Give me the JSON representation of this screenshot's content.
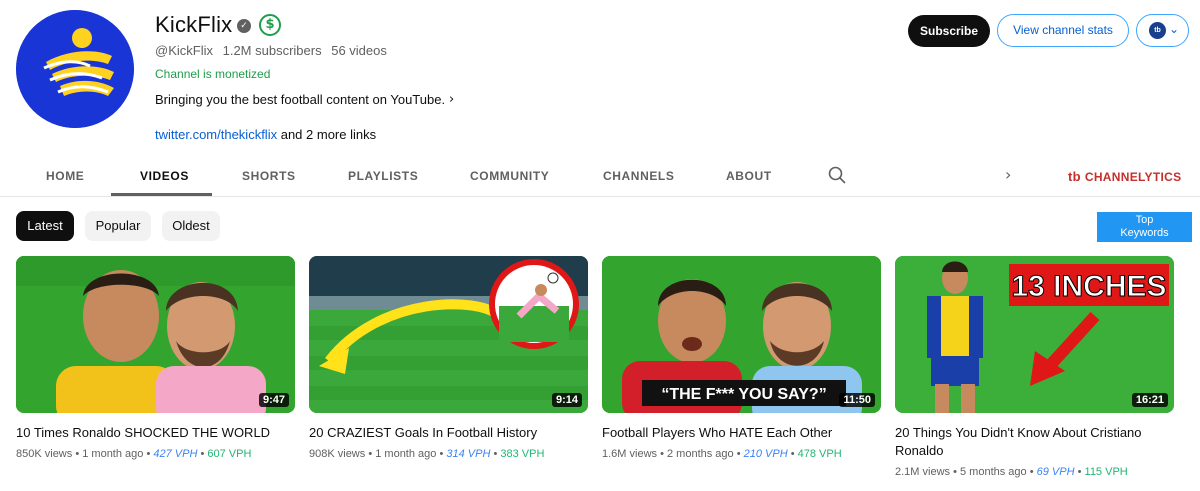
{
  "channel": {
    "name": "KickFlix",
    "handle": "@KickFlix",
    "subscribers": "1.2M subscribers",
    "videos_count": "56 videos",
    "monetized": "Channel is monetized",
    "description": "Bringing you the best football content on YouTube.",
    "link": "twitter.com/thekickflix",
    "more_links": "and 2 more links",
    "brand_color": "#1a35d6"
  },
  "actions": {
    "subscribe": "Subscribe",
    "view_stats": "View channel stats",
    "ext_icon": "channelytics-logo-icon"
  },
  "tabs": [
    {
      "label": "HOME",
      "active": false
    },
    {
      "label": "VIDEOS",
      "active": true
    },
    {
      "label": "SHORTS",
      "active": false
    },
    {
      "label": "PLAYLISTS",
      "active": false
    },
    {
      "label": "COMMUNITY",
      "active": false
    },
    {
      "label": "CHANNELS",
      "active": false
    },
    {
      "label": "ABOUT",
      "active": false
    }
  ],
  "channelytics": {
    "label": "CHANNELYTICS",
    "logo": "tb",
    "color": "#c4302b"
  },
  "filters": [
    {
      "label": "Latest",
      "active": true
    },
    {
      "label": "Popular",
      "active": false
    },
    {
      "label": "Oldest",
      "active": false
    }
  ],
  "top_keywords": {
    "line1": "Top",
    "line2": "Keywords"
  },
  "videos": [
    {
      "title": "10 Times Ronaldo SHOCKED THE WORLD",
      "views": "850K views",
      "age": "1 month ago",
      "vph1": "427 VPH",
      "vph2": "607 VPH",
      "duration": "9:47"
    },
    {
      "title": "20 CRAZIEST Goals In Football History",
      "views": "908K views",
      "age": "1 month ago",
      "vph1": "314 VPH",
      "vph2": "383 VPH",
      "duration": "9:14"
    },
    {
      "title": "Football Players Who HATE Each Other",
      "views": "1.6M views",
      "age": "2 months ago",
      "vph1": "210 VPH",
      "vph2": "478 VPH",
      "duration": "11:50",
      "overlay": "“THE F*** YOU SAY?”"
    },
    {
      "title": "20 Things You Didn't Know About Cristiano Ronaldo",
      "views": "2.1M views",
      "age": "5 months ago",
      "vph1": "69 VPH",
      "vph2": "115 VPH",
      "duration": "16:21",
      "overlay": "13 INCHES"
    }
  ]
}
